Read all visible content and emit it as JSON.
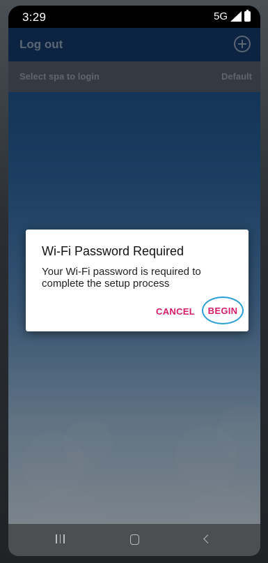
{
  "status_bar": {
    "time": "3:29",
    "network": "5G"
  },
  "app_bar": {
    "logout_label": "Log out",
    "add_icon": "plus-circle-icon"
  },
  "spa_selector": {
    "label": "Select spa to login",
    "value": "Default"
  },
  "dialog": {
    "title": "Wi-Fi Password Required",
    "message": "Your Wi-Fi password is required to complete the setup process",
    "cancel_label": "CANCEL",
    "begin_label": "BEGIN"
  },
  "nav_bar": {
    "recent_icon": "recent-apps-icon",
    "home_icon": "home-icon",
    "back_icon": "back-icon"
  },
  "colors": {
    "dialog_button": "#d61b6b",
    "highlight_ring": "#2a9fd8",
    "app_bar": "#153f73"
  }
}
